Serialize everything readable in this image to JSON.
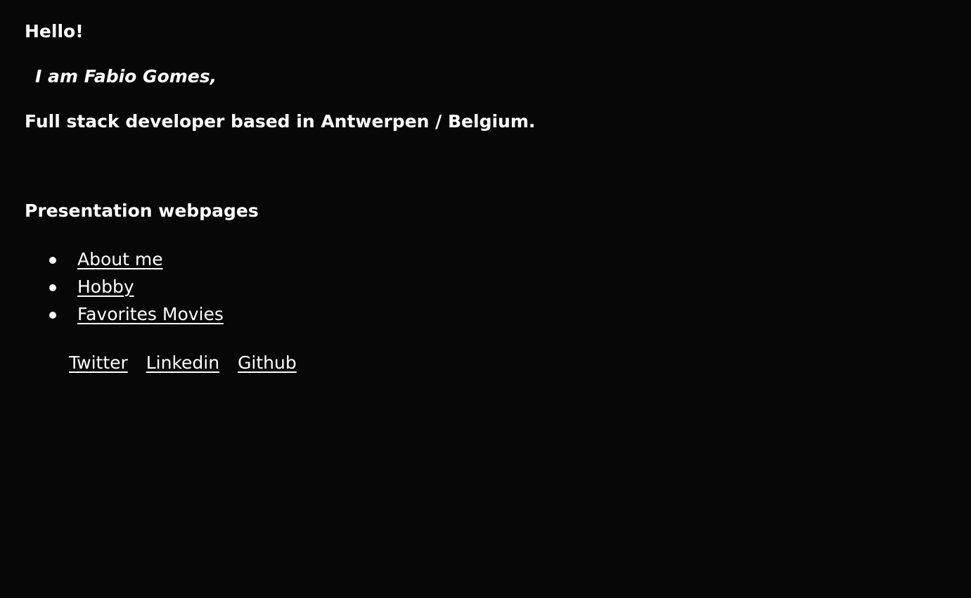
{
  "header": {
    "greeting": "Hello!",
    "intro": "I am Fabio Gomes,",
    "role": "Full stack developer based in Antwerpen / Belgium."
  },
  "presentation": {
    "title": "Presentation webpages",
    "links": [
      {
        "label": "About me"
      },
      {
        "label": "Hobby"
      },
      {
        "label": "Favorites Movies"
      }
    ]
  },
  "social": {
    "links": [
      {
        "label": "Twitter"
      },
      {
        "label": "Linkedin"
      },
      {
        "label": "Github"
      }
    ]
  },
  "colors": {
    "background": "#070707",
    "text": "#ffffff"
  }
}
